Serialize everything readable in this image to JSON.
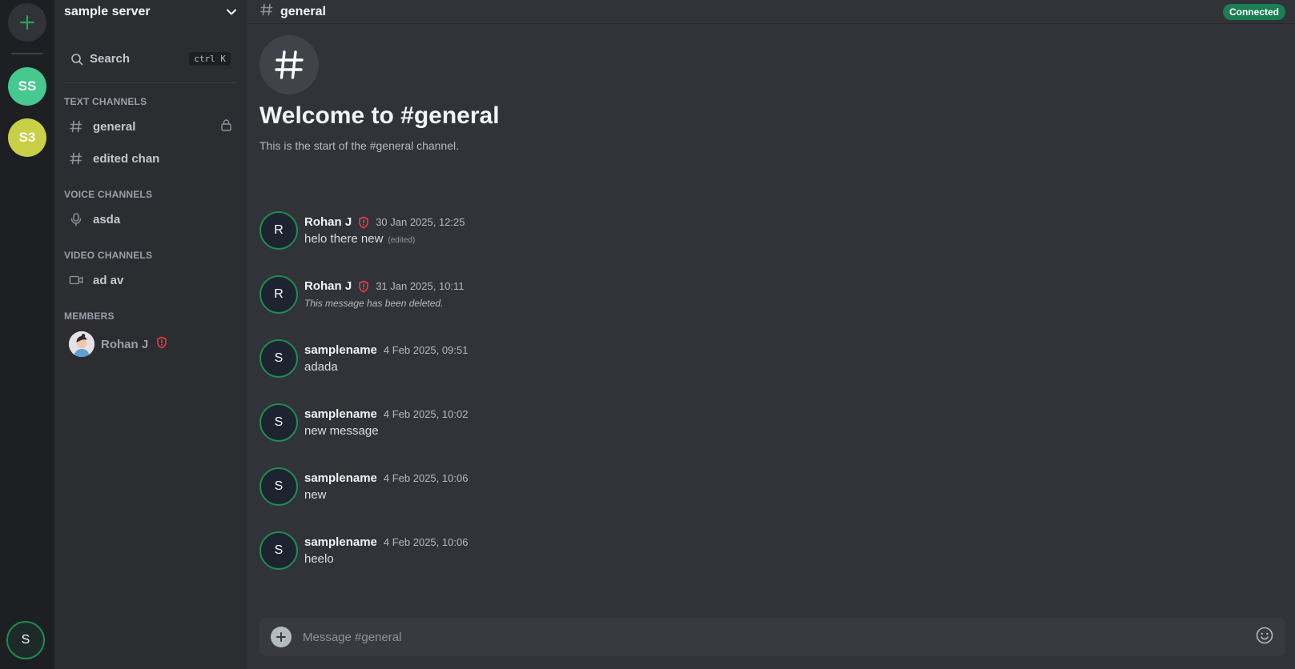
{
  "rail": {
    "add_icon": "plus-icon",
    "servers": [
      {
        "label": "SS",
        "color": "#45c98f"
      },
      {
        "label": "S3",
        "color": "#c9cf46"
      }
    ],
    "user_initial": "S"
  },
  "sidebar": {
    "server_name": "sample server",
    "search": {
      "label": "Search",
      "shortcut_ctrl": "ctrl",
      "shortcut_key": "K"
    },
    "sections": {
      "text": "TEXT CHANNELS",
      "voice": "VOICE CHANNELS",
      "video": "VIDEO CHANNELS",
      "members": "MEMBERS"
    },
    "text_channels": [
      {
        "label": "general",
        "locked": true
      },
      {
        "label": "edited chan"
      }
    ],
    "voice_channels": [
      {
        "label": "asda"
      }
    ],
    "video_channels": [
      {
        "label": "ad av"
      }
    ],
    "members": [
      {
        "name": "Rohan J",
        "role_icon": "shield-alert-icon"
      }
    ]
  },
  "header": {
    "channel": "general",
    "status": "Connected",
    "status_color": "#1a7f52"
  },
  "welcome": {
    "title": "Welcome to #general",
    "subtitle": "This is the start of the #general channel."
  },
  "messages": [
    {
      "initial": "R",
      "author": "Rohan J",
      "shield": true,
      "time": "30 Jan 2025, 12:25",
      "text": "helo there new",
      "edited": "(edited)"
    },
    {
      "initial": "R",
      "author": "Rohan J",
      "shield": true,
      "time": "31 Jan 2025, 10:11",
      "text": "This message has been deleted."
    },
    {
      "initial": "S",
      "author": "samplename",
      "time": "4 Feb 2025, 09:51",
      "text": "adada"
    },
    {
      "initial": "S",
      "author": "samplename",
      "time": "4 Feb 2025, 10:02",
      "text": "new message"
    },
    {
      "initial": "S",
      "author": "samplename",
      "time": "4 Feb 2025, 10:06",
      "text": "new"
    },
    {
      "initial": "S",
      "author": "samplename",
      "time": "4 Feb 2025, 10:06",
      "text": "heelo"
    }
  ],
  "composer": {
    "placeholder": "Message #general",
    "emoji_icon": "smiley-icon"
  }
}
